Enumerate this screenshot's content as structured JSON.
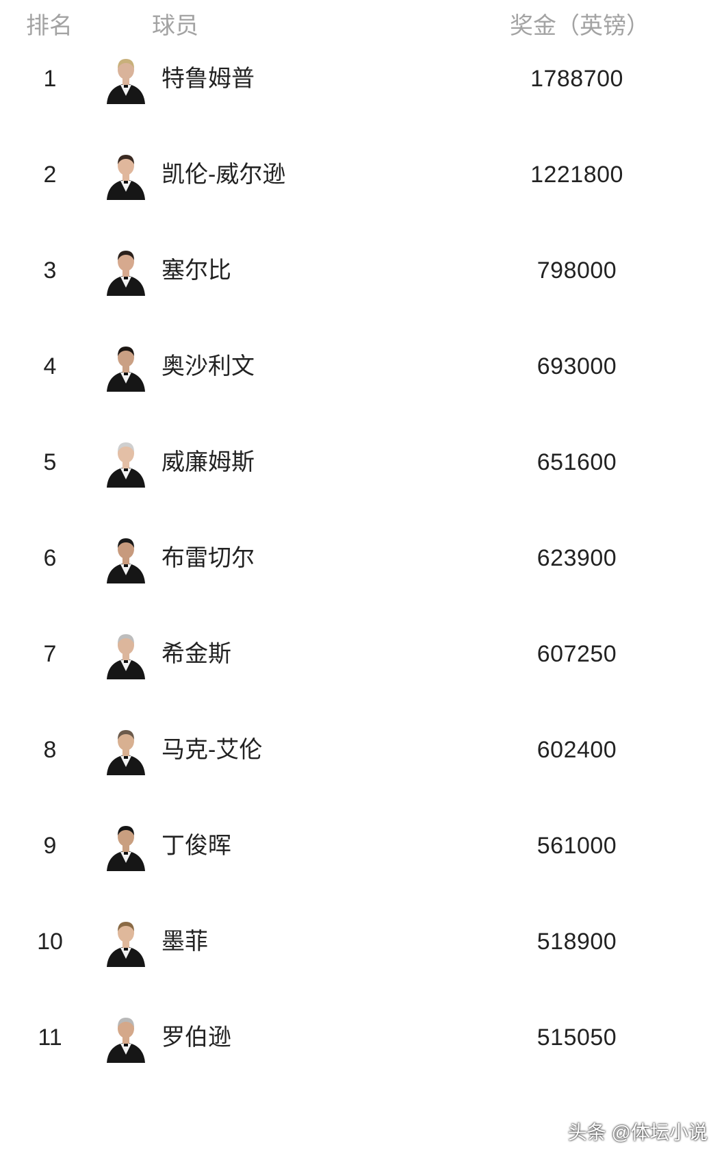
{
  "header": {
    "rank": "排名",
    "player": "球员",
    "prize": "奖金（英镑）"
  },
  "rows": [
    {
      "rank": "1",
      "name": "特鲁姆普",
      "prize": "1788700",
      "avatar": "player-photo-icon"
    },
    {
      "rank": "2",
      "name": "凯伦-威尔逊",
      "prize": "1221800",
      "avatar": "player-photo-icon"
    },
    {
      "rank": "3",
      "name": "塞尔比",
      "prize": "798000",
      "avatar": "player-photo-icon"
    },
    {
      "rank": "4",
      "name": "奥沙利文",
      "prize": "693000",
      "avatar": "player-photo-icon"
    },
    {
      "rank": "5",
      "name": "威廉姆斯",
      "prize": "651600",
      "avatar": "player-photo-icon"
    },
    {
      "rank": "6",
      "name": "布雷切尔",
      "prize": "623900",
      "avatar": "player-photo-icon"
    },
    {
      "rank": "7",
      "name": "希金斯",
      "prize": "607250",
      "avatar": "player-photo-icon"
    },
    {
      "rank": "8",
      "name": "马克-艾伦",
      "prize": "602400",
      "avatar": "player-photo-icon"
    },
    {
      "rank": "9",
      "name": "丁俊晖",
      "prize": "561000",
      "avatar": "player-photo-icon"
    },
    {
      "rank": "10",
      "name": "墨菲",
      "prize": "518900",
      "avatar": "player-photo-icon"
    },
    {
      "rank": "11",
      "name": "罗伯逊",
      "prize": "515050",
      "avatar": "player-photo-icon"
    }
  ],
  "watermark": "头条 @体坛小说",
  "colors": {
    "header_text": "#a3a3a3",
    "body_text": "#222222",
    "background": "#ffffff"
  }
}
